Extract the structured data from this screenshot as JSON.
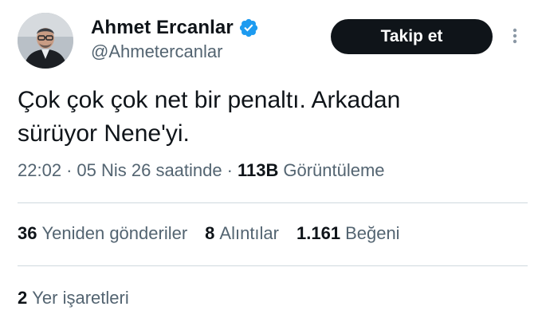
{
  "author": {
    "display_name": "Ahmet Ercanlar",
    "handle": "@Ahmetercanlar",
    "verified": true,
    "verified_color": "#1d9bf0"
  },
  "follow_button": {
    "label": "Takip et"
  },
  "tweet": {
    "text": "Çok çok çok net bir penaltı. Arkadan\nsürüyor Nene'yi."
  },
  "meta": {
    "time": "22:02",
    "separator": "·",
    "date": "05 Nis 26 saatinde",
    "views_count": "113B",
    "views_label": "Görüntüleme"
  },
  "stats": {
    "retweets": {
      "count": "36",
      "label": "Yeniden gönderiler"
    },
    "quotes": {
      "count": "8",
      "label": "Alıntılar"
    },
    "likes": {
      "count": "1.161",
      "label": "Beğeni"
    },
    "bookmarks": {
      "count": "2",
      "label": "Yer işaretleri"
    }
  },
  "colors": {
    "text_primary": "#0f1419",
    "text_secondary": "#536471",
    "divider": "#cfd9de",
    "button_bg": "#0f1419"
  }
}
